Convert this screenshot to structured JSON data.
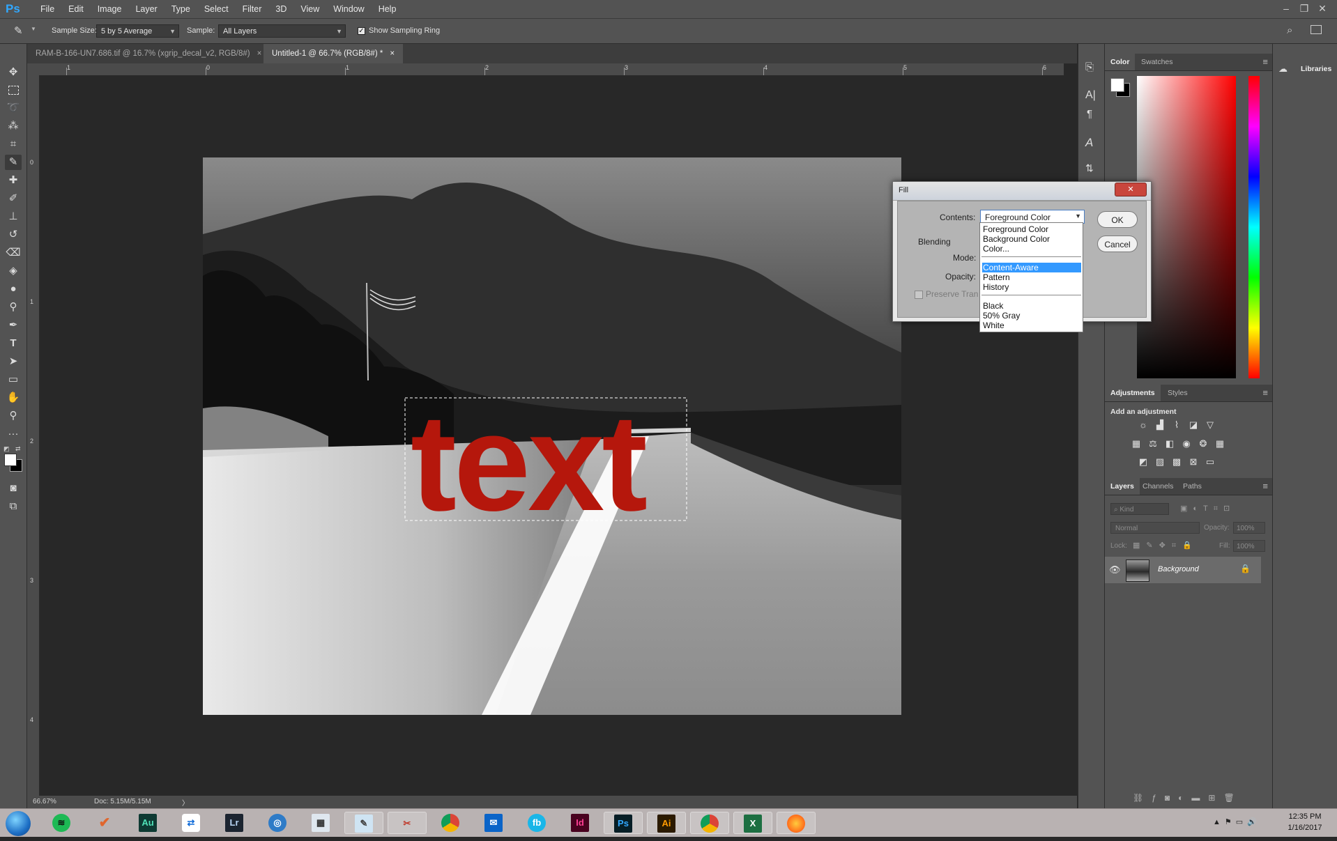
{
  "app": {
    "logo": "Ps"
  },
  "menu": [
    "File",
    "Edit",
    "Image",
    "Layer",
    "Type",
    "Select",
    "Filter",
    "3D",
    "View",
    "Window",
    "Help"
  ],
  "window_controls": {
    "minimize": "–",
    "restore": "❐",
    "close": "✕"
  },
  "options_bar": {
    "sample_size_label": "Sample Size:",
    "sample_size_value": "5 by 5 Average",
    "sample_label": "Sample:",
    "sample_value": "All Layers",
    "show_ring_label": "Show Sampling Ring",
    "show_ring_checked": true
  },
  "tabs": [
    {
      "label": "RAM-B-166-UN7.686.tif @ 16.7% (xgrip_decal_v2, RGB/8#)",
      "close": "×"
    },
    {
      "label": "Untitled-1 @ 66.7% (RGB/8#) *",
      "close": "×"
    }
  ],
  "rulers": {
    "h": [
      "1",
      "0",
      "1",
      "2",
      "3",
      "4",
      "5",
      "6"
    ],
    "v": [
      "0",
      "1",
      "2",
      "3",
      "4"
    ]
  },
  "canvas": {
    "text_layer": "text"
  },
  "status": {
    "zoom": "66.67%",
    "doc": "Doc: 5.15M/5.15M",
    "arrow": "〉"
  },
  "fill_dialog": {
    "title": "Fill",
    "contents_label": "Contents:",
    "contents_value": "Foreground Color",
    "blending_label": "Blending",
    "mode_label": "Mode:",
    "opacity_label": "Opacity:",
    "preserve_label": "Preserve Tran",
    "ok": "OK",
    "cancel": "Cancel",
    "close": "✕"
  },
  "dropdown_options": {
    "group1": [
      "Foreground Color",
      "Background Color",
      "Color..."
    ],
    "group2": [
      "Content-Aware",
      "Pattern",
      "History"
    ],
    "group3": [
      "Black",
      "50% Gray",
      "White"
    ],
    "selected": "Content-Aware"
  },
  "color_panel": {
    "tabs": [
      "Color",
      "Swatches"
    ],
    "foreground": "#ffffff",
    "background": "#000000"
  },
  "adjustments_panel": {
    "tabs": [
      "Adjustments",
      "Styles"
    ],
    "heading": "Add an adjustment"
  },
  "layers_panel": {
    "tabs": [
      "Layers",
      "Channels",
      "Paths"
    ],
    "kind_placeholder": "Kind",
    "blend_mode": "Normal",
    "opacity_label": "Opacity:",
    "opacity_value": "100%",
    "lock_label": "Lock:",
    "fill_label": "Fill:",
    "fill_value": "100%",
    "layers": [
      {
        "name": "Background",
        "visible": true,
        "locked": true
      }
    ]
  },
  "libraries": {
    "label": "Libraries"
  },
  "taskbar": {
    "apps": [
      "start",
      "spotify",
      "todo",
      "audition",
      "teamviewer",
      "lightroom",
      "camera",
      "calculator",
      "notepad",
      "snipping",
      "chrome",
      "outlook",
      "fb",
      "indesign",
      "photoshop",
      "illustrator",
      "chrome2",
      "excel",
      "firefox"
    ],
    "app_labels": {
      "audition": "Au",
      "lightroom": "Lr",
      "indesign": "Id",
      "photoshop": "Ps",
      "illustrator": "Ai",
      "excel": "X",
      "fb": "fb"
    },
    "time": "12:35 PM",
    "date": "1/16/2017"
  },
  "colors": {
    "accent": "#31a8ff",
    "text_red": "#b5170c",
    "selection": "#3399ff"
  }
}
